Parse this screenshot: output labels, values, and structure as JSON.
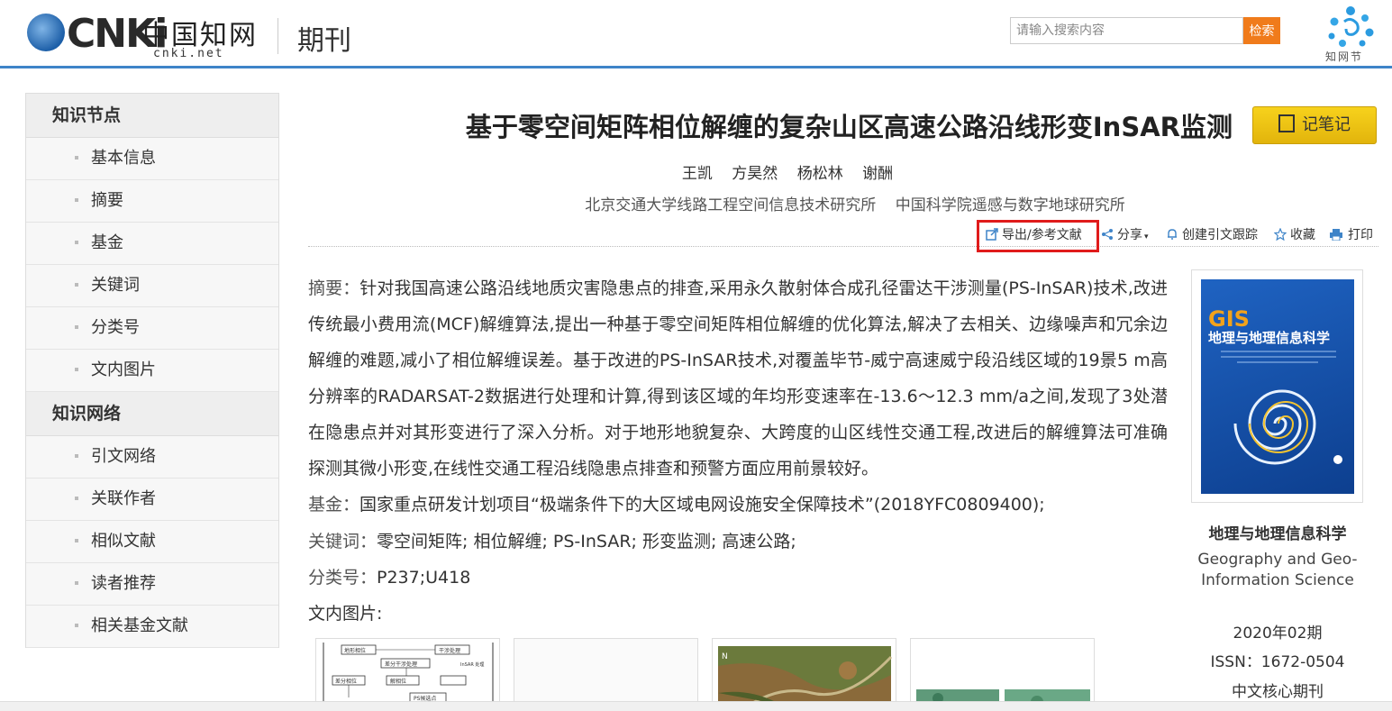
{
  "header": {
    "logo_text": "CNKi",
    "logo_cn": "中国知网",
    "logo_domain": "cnki.net",
    "section": "期刊",
    "search_placeholder": "请输入搜索内容",
    "search_button": "检索",
    "zhiwang_jie": "知网节"
  },
  "sidebar": {
    "groups": [
      {
        "title": "知识节点",
        "items": [
          "基本信息",
          "摘要",
          "基金",
          "关键词",
          "分类号",
          "文内图片"
        ]
      },
      {
        "title": "知识网络",
        "items": [
          "引文网络",
          "关联作者",
          "相似文献",
          "读者推荐",
          "相关基金文献"
        ]
      }
    ]
  },
  "article": {
    "title": "基于零空间矩阵相位解缠的复杂山区高速公路沿线形变InSAR监测",
    "note_button": "记笔记",
    "authors": [
      "王凯",
      "方昊然",
      "杨松林",
      "谢酬"
    ],
    "institutions": [
      "北京交通大学线路工程空间信息技术研究所",
      "中国科学院遥感与数字地球研究所"
    ],
    "toolbar": {
      "export": "导出/参考文献",
      "share": "分享",
      "track": "创建引文跟踪",
      "favorite": "收藏",
      "print": "打印"
    },
    "abstract_label": "摘要：",
    "abstract": "针对我国高速公路沿线地质灾害隐患点的排查,采用永久散射体合成孔径雷达干涉测量(PS-InSAR)技术,改进传统最小费用流(MCF)解缠算法,提出一种基于零空间矩阵相位解缠的优化算法,解决了去相关、边缘噪声和冗余边解缠的难题,减小了相位解缠误差。基于改进的PS-InSAR技术,对覆盖毕节-威宁高速威宁段沿线区域的19景5 m高分辨率的RADARSAT-2数据进行处理和计算,得到该区域的年均形变速率在-13.6～12.3 mm/a之间,发现了3处潜在隐患点并对其形变进行了深入分析。对于地形地貌复杂、大跨度的山区线性交通工程,改进后的解缠算法可准确探测其微小形变,在线性交通工程沿线隐患点排查和预警方面应用前景较好。",
    "fund_label": "基金：",
    "fund": "国家重点研发计划项目“极端条件下的大区域电网设施安全保障技术”(2018YFC0809400);",
    "keywords_label": "关键词：",
    "keywords": "零空间矩阵; 相位解缠; PS-InSAR; 形变监测; 高速公路;",
    "class_label": "分类号：",
    "class": "P237;U418",
    "figures_label": "文内图片:"
  },
  "journal": {
    "cover_title": "地理与地理信息科学",
    "cover_logo": "GIS",
    "name": "地理与地理信息科学",
    "name_en": "Geography and Geo-Information Science",
    "issue": "2020年02期",
    "issn": "ISSN：1672-0504",
    "core": "中文核心期刊"
  },
  "figure_labels": {
    "box1": "地形相位",
    "box2": "干涉处理",
    "box3": "差分干涉处理",
    "box4": "InSAR 处理",
    "box5": "差分相位",
    "box6": "解相位",
    "box7": "PS候选点"
  }
}
